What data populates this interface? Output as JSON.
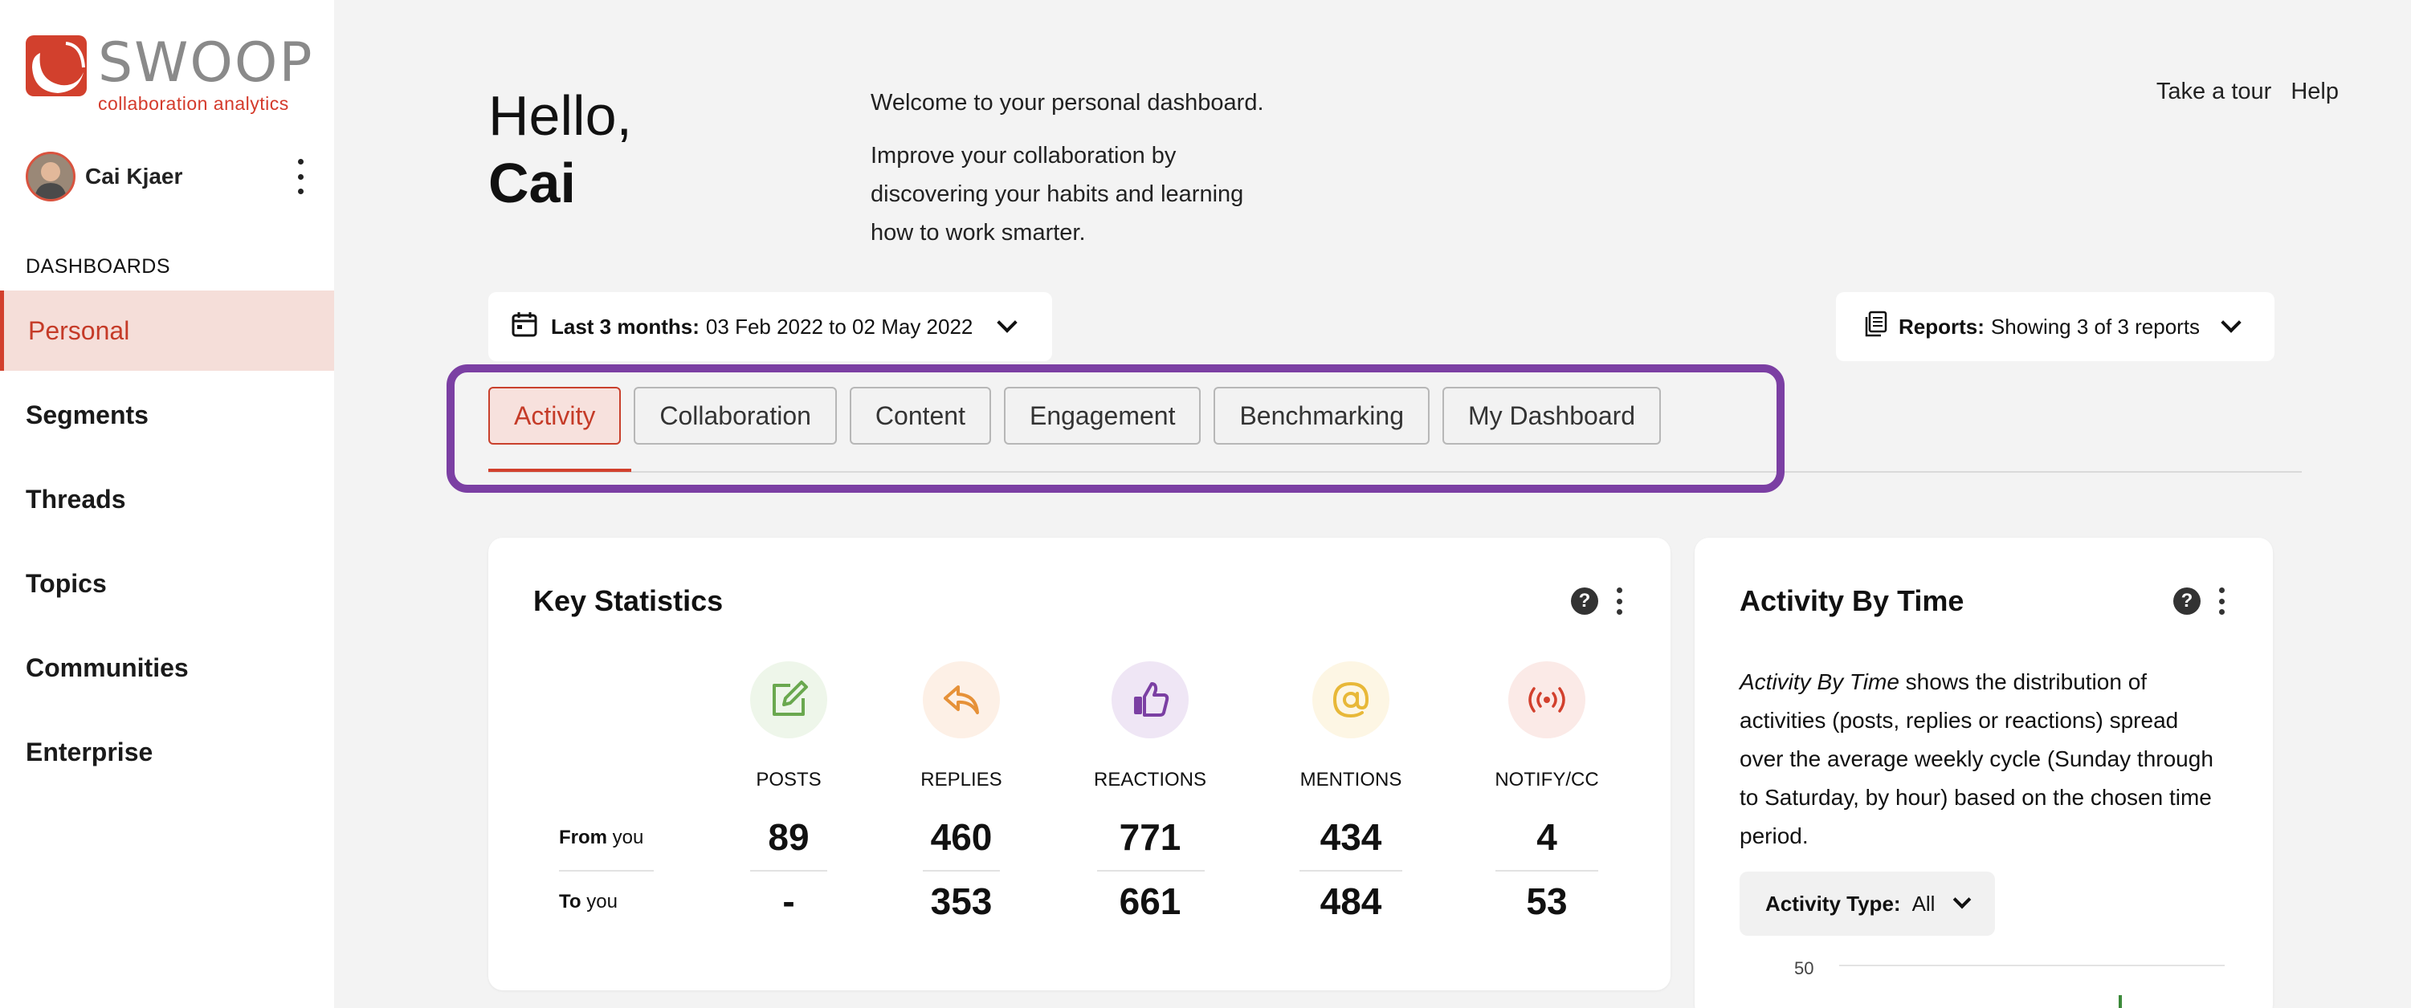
{
  "brand": {
    "name": "SWOOP",
    "tagline": "collaboration analytics",
    "accent_color": "#d2402d"
  },
  "user": {
    "name": "Cai Kjaer"
  },
  "sidebar": {
    "section_label": "DASHBOARDS",
    "items": [
      {
        "label": "Personal",
        "active": true
      },
      {
        "label": "Segments"
      },
      {
        "label": "Threads"
      },
      {
        "label": "Topics"
      },
      {
        "label": "Communities"
      },
      {
        "label": "Enterprise"
      }
    ]
  },
  "header": {
    "greeting": "Hello,",
    "first_name": "Cai",
    "welcome_line": "Welcome to your personal dashboard.",
    "welcome_body": "Improve your collaboration by discovering your habits and learning how to work smarter.",
    "links": [
      "Take a tour",
      "Help"
    ]
  },
  "filters": {
    "date_label": "Last 3 months:",
    "date_range": "03 Feb 2022 to 02 May 2022",
    "reports_label": "Reports:",
    "reports_value": "Showing 3 of 3 reports"
  },
  "tabs": [
    {
      "label": "Activity",
      "active": true
    },
    {
      "label": "Collaboration"
    },
    {
      "label": "Content"
    },
    {
      "label": "Engagement"
    },
    {
      "label": "Benchmarking"
    },
    {
      "label": "My Dashboard"
    }
  ],
  "highlight_color": "#7b3fa3",
  "key_statistics": {
    "title": "Key Statistics",
    "help_glyph": "?",
    "row_labels": [
      {
        "strong": "From",
        "rest": " you"
      },
      {
        "strong": "To",
        "rest": " you"
      }
    ],
    "columns": [
      {
        "label": "POSTS",
        "icon": "edit-icon",
        "color": "#6aa84f",
        "bg": "#eef6ea",
        "from": "89",
        "to": "-"
      },
      {
        "label": "REPLIES",
        "icon": "reply-icon",
        "color": "#e69138",
        "bg": "#fdf0e6",
        "from": "460",
        "to": "353"
      },
      {
        "label": "REACTIONS",
        "icon": "thumbs-up-icon",
        "color": "#7b3fa3",
        "bg": "#efe6f5",
        "from": "771",
        "to": "661"
      },
      {
        "label": "MENTIONS",
        "icon": "at-icon",
        "color": "#e8b838",
        "bg": "#fdf6e4",
        "from": "434",
        "to": "484"
      },
      {
        "label": "NOTIFY/CC",
        "icon": "broadcast-icon",
        "color": "#d2402d",
        "bg": "#fbeae7",
        "from": "4",
        "to": "53"
      }
    ]
  },
  "activity_by_time": {
    "title": "Activity By Time",
    "help_glyph": "?",
    "description_em": "Activity By Time",
    "description_rest": " shows the distribution of activities (posts, replies or reactions) spread over the average weekly cycle (Sunday through to Saturday, by hour) based on the chosen time period.",
    "activity_type_label": "Activity Type:",
    "activity_type_value": "All",
    "axis_tick": "50"
  }
}
